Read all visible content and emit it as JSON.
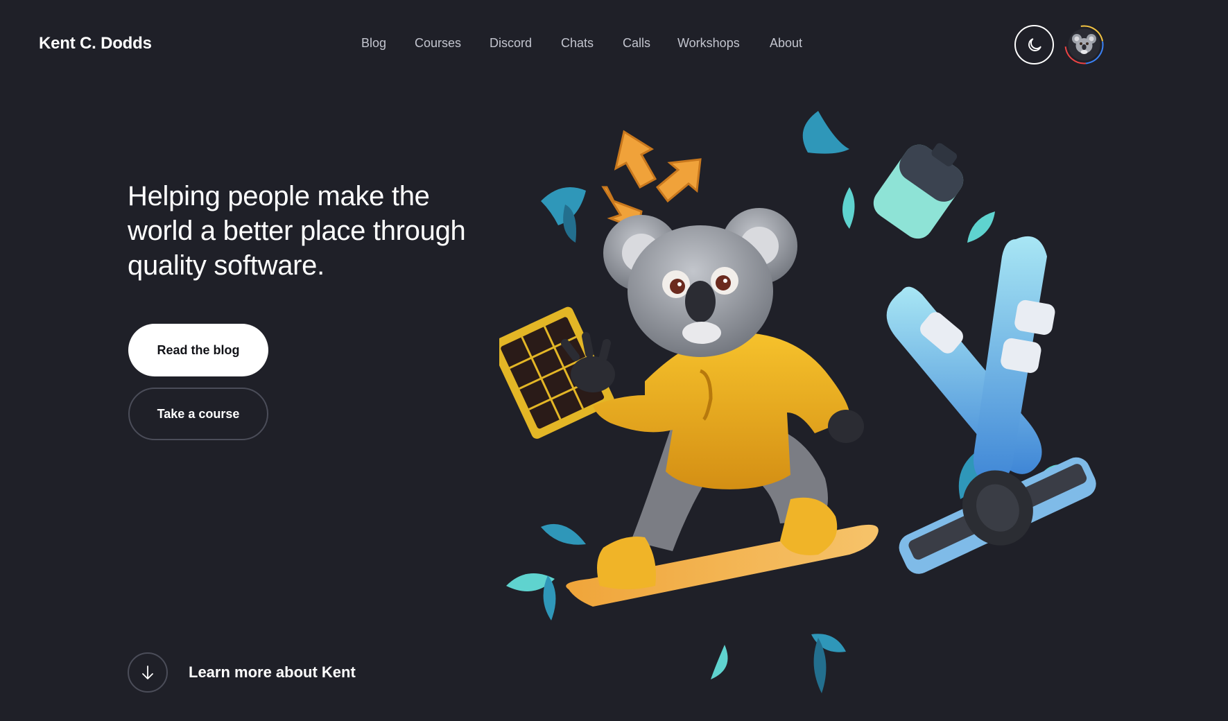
{
  "header": {
    "logo": "Kent C. Dodds",
    "nav": [
      {
        "label": "Blog"
      },
      {
        "label": "Courses"
      },
      {
        "label": "Discord"
      },
      {
        "label": "Chats"
      },
      {
        "label": "Calls"
      },
      {
        "label": "Workshops"
      },
      {
        "label": "About"
      }
    ],
    "theme_toggle_icon": "moon-icon",
    "avatar_icon": "koala-avatar"
  },
  "hero": {
    "headline": "Helping people make the world a better place through quality software.",
    "primary_cta": "Read the blog",
    "secondary_cta": "Take a course",
    "learn_more": "Learn more about Kent",
    "learn_more_icon": "arrow-down-icon",
    "illustration": "koala-snowboarder-illustration"
  },
  "colors": {
    "background": "#1f2028",
    "text": "#ffffff",
    "nav_text": "#c3c5cf",
    "leaf": "#2f97b9",
    "leaf_light": "#5fd3cf",
    "sweater": "#f2b01e",
    "board": "#f3a93a"
  }
}
